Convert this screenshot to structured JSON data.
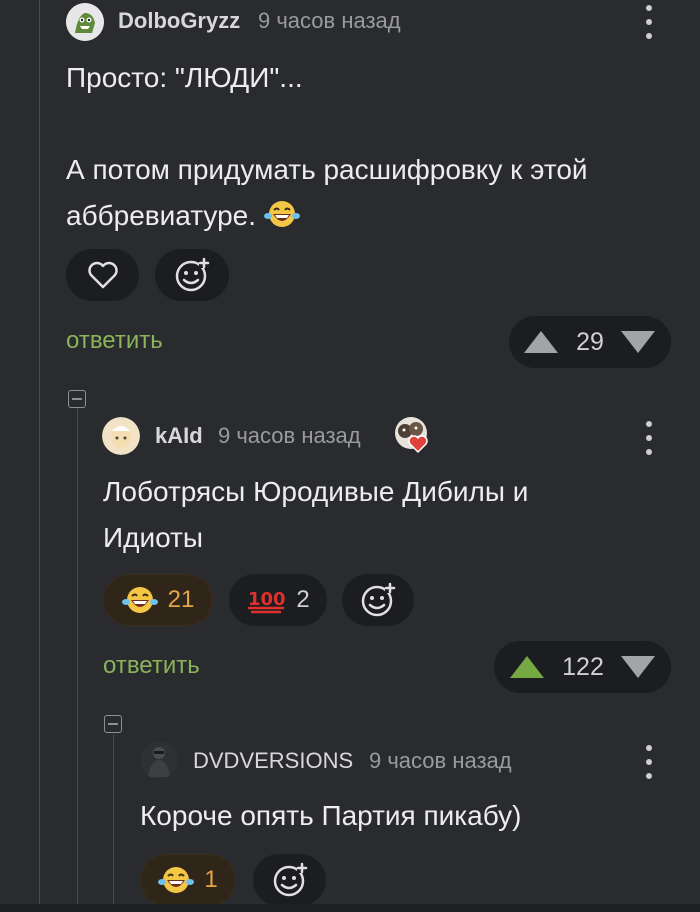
{
  "comments": [
    {
      "user": "DolboGryzz",
      "time": "9 часов назад",
      "text": "Просто: \"ЛЮДИ\"...\n\nА потом придумать расшифровку к этой аббревиатуре.",
      "reply_label": "ответить",
      "score": "29"
    },
    {
      "user": "kAId",
      "time": "9 часов назад",
      "text": "Лоботрясы Юродивые Дибилы и Идиоты",
      "reactions": [
        {
          "icon": "laughing-emoji",
          "count": "21"
        },
        {
          "icon": "hundred-points-emoji",
          "count": "2"
        }
      ],
      "reply_label": "ответить",
      "score": "122"
    },
    {
      "user": "DVDVERSIONS",
      "time": "9 часов назад",
      "text": "Короче опять Партия пикабу)",
      "reactions": [
        {
          "icon": "laughing-emoji",
          "count": "1"
        }
      ]
    }
  ],
  "colors": {
    "background": "#2a2b2e",
    "pill": "#1c1d20",
    "reply_green": "#8ab35a",
    "upvote_active": "#76a843",
    "reaction_count_orange": "#e3a44a"
  }
}
